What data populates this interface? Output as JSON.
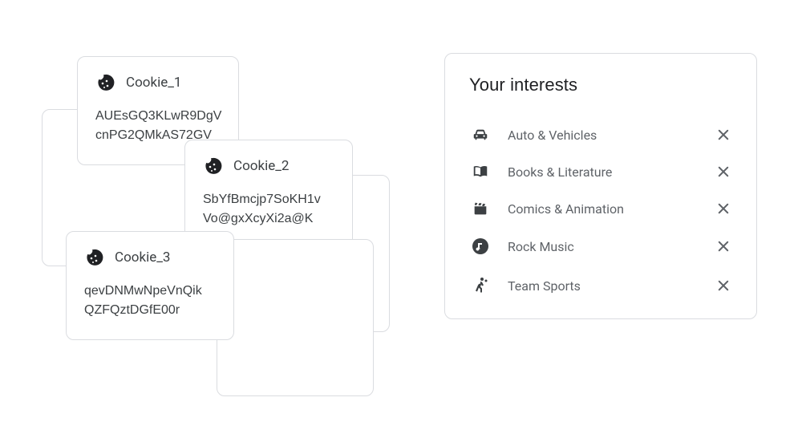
{
  "cookies": [
    {
      "title": "Cookie_1",
      "data": "AUEsGQ3KLwR9DgV\ncnPG2QMkAS72GV"
    },
    {
      "title": "Cookie_2",
      "data": "SbYfBmcjp7SoKH1v\nVo@gxXcyXi2a@K"
    },
    {
      "title": "Cookie_3",
      "data": "qevDNMwNpeVnQik\nQZFQztDGfE00r"
    }
  ],
  "interests": {
    "title": "Your interests",
    "items": [
      {
        "label": "Auto & Vehicles",
        "icon": "car"
      },
      {
        "label": "Books & Literature",
        "icon": "book"
      },
      {
        "label": "Comics & Animation",
        "icon": "clapper"
      },
      {
        "label": "Rock Music",
        "icon": "music"
      },
      {
        "label": "Team Sports",
        "icon": "sport"
      }
    ]
  }
}
